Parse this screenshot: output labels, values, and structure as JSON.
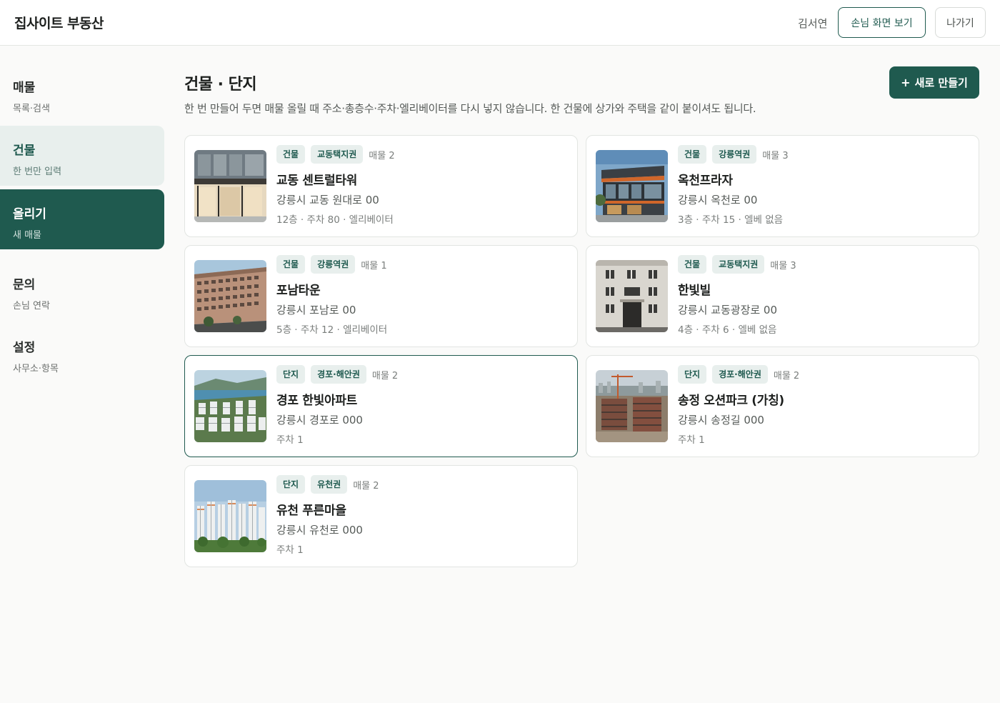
{
  "header": {
    "brand": "집사이트 부동산",
    "user_name": "김서연",
    "guest_view_label": "손님 화면 보기",
    "exit_label": "나가기"
  },
  "sidebar": {
    "items": [
      {
        "title": "매물",
        "sub": "목록·검색",
        "state": "normal"
      },
      {
        "title": "건물",
        "sub": "한 번만 입력",
        "state": "soft"
      },
      {
        "title": "올리기",
        "sub": "새 매물",
        "state": "active"
      },
      {
        "title": "문의",
        "sub": "손님 연락",
        "state": "normal"
      },
      {
        "title": "설정",
        "sub": "사무소·항목",
        "state": "normal"
      }
    ]
  },
  "main": {
    "title": "건물 · 단지",
    "description": "한 번 만들어 두면 매물 올릴 때 주소·총층수·주차·엘리베이터를 다시 넣지 않습니다. 한 건물에 상가와 주택을 같이 붙이셔도 됩니다.",
    "new_button": {
      "icon": "+",
      "label": "새로 만들기"
    }
  },
  "cards": [
    {
      "type": "건물",
      "area": "교동택지권",
      "count": "매물 2",
      "name": "교동 센트럴타워",
      "address": "강릉시 교동 원대로 00",
      "meta": "12층 · 주차 80 · 엘리베이터",
      "image": "glass-office-tower-photo",
      "selected": false
    },
    {
      "type": "건물",
      "area": "강릉역권",
      "count": "매물 3",
      "name": "옥천프라자",
      "address": "강릉시 옥천로 00",
      "meta": "3층 · 주차 15 · 엘베 없음",
      "image": "commercial-plaza-photo",
      "selected": false
    },
    {
      "type": "건물",
      "area": "강릉역권",
      "count": "매물 1",
      "name": "포남타운",
      "address": "강릉시 포남로 00",
      "meta": "5층 · 주차 12 · 엘리베이터",
      "image": "apartment-block-street-photo",
      "selected": false
    },
    {
      "type": "건물",
      "area": "교동택지권",
      "count": "매물 3",
      "name": "한빛빌",
      "address": "강릉시 교동광장로 00",
      "meta": "4층 · 주차 6 · 엘베 없음",
      "image": "villa-facade-photo",
      "selected": false
    },
    {
      "type": "단지",
      "area": "경포·해안권",
      "count": "매물 2",
      "name": "경포 한빛아파트",
      "address": "강릉시 경포로 000",
      "meta": "주차 1",
      "image": "coastal-apartment-complex-photo",
      "selected": true
    },
    {
      "type": "단지",
      "area": "경포·해안권",
      "count": "매물 2",
      "name": "송정 오션파크 (가칭)",
      "address": "강릉시 송정길 000",
      "meta": "주차 1",
      "image": "construction-site-photo",
      "selected": false
    },
    {
      "type": "단지",
      "area": "유천권",
      "count": "매물 2",
      "name": "유천 푸른마을",
      "address": "강릉시 유천로 000",
      "meta": "주차 1",
      "image": "highrise-apartments-photo",
      "selected": false
    }
  ]
}
